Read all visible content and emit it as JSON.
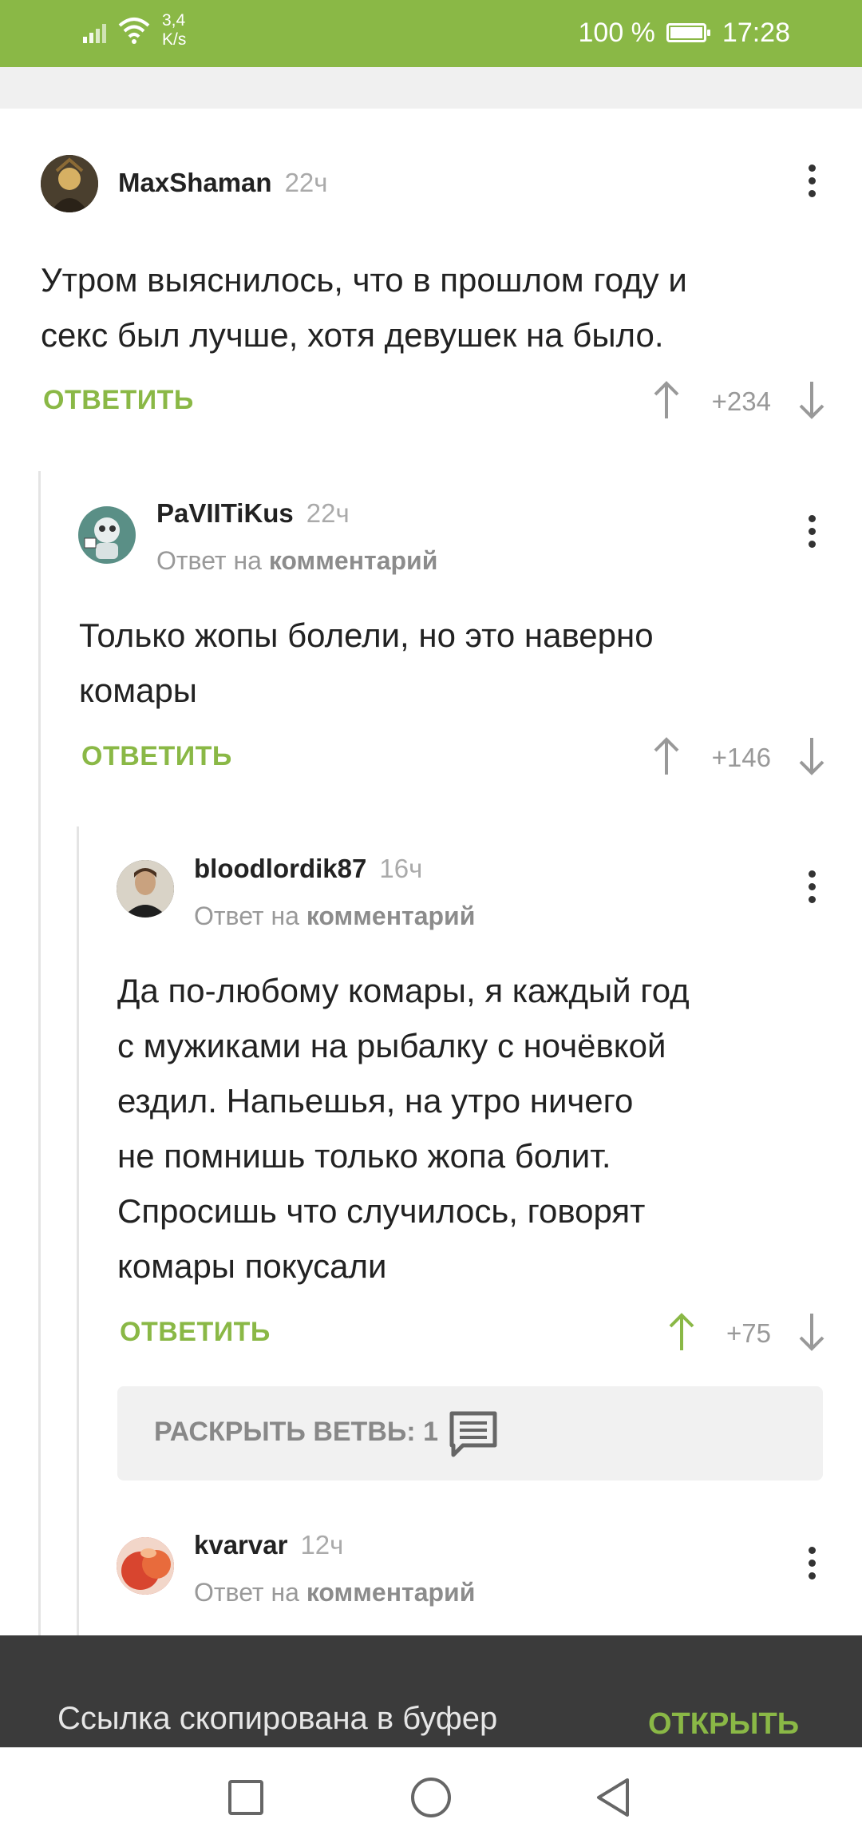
{
  "status_bar": {
    "net_speed_value": "3,4",
    "net_speed_unit": "K/s",
    "battery": "100 %",
    "time": "17:28"
  },
  "comments": [
    {
      "username": "MaxShaman",
      "time": "22ч",
      "text_lines": [
        "Утром выяснилось, что в прошлом году и",
        "секс был лучше, хотя девушек на было."
      ],
      "reply_label": "ОТВЕТИТЬ",
      "score": "+234"
    },
    {
      "username": "PaVIITiKus",
      "time": "22ч",
      "reply_prefix": "Ответ на",
      "reply_link": "комментарий",
      "text_lines": [
        "Только жопы болели, но это наверно",
        "комары"
      ],
      "reply_label": "ОТВЕТИТЬ",
      "score": "+146"
    },
    {
      "username": "bloodlordik87",
      "time": "16ч",
      "reply_prefix": "Ответ на",
      "reply_link": "комментарий",
      "text_lines": [
        "Да по-любому комары, я каждый год",
        "с мужиками на рыбалку с ночёвкой",
        "ездил. Напьешья, на утро ничего",
        "не помнишь только жопа болит.",
        "Спросишь что случилось, говорят",
        "комары покусали"
      ],
      "reply_label": "ОТВЕТИТЬ",
      "score": "+75"
    },
    {
      "username": "kvarvar",
      "time": "12ч",
      "reply_prefix": "Ответ на",
      "reply_link": "комментарий"
    }
  ],
  "expand_branch": "РАСКРЫТЬ ВЕТВЬ: 1",
  "snackbar": {
    "message": "Ссылка скопирована в буфер",
    "action": "ОТКРЫТЬ"
  },
  "colors": {
    "accent": "#8ab846",
    "upvoted": "#8ab846",
    "snackbar_bg": "#3b3b3b"
  }
}
